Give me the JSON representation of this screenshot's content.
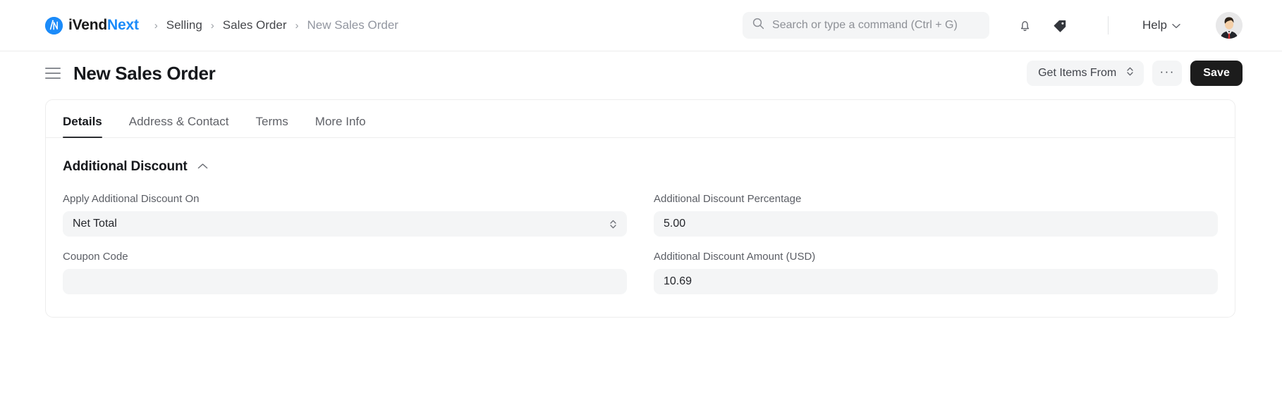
{
  "navbar": {
    "brand": {
      "part1": "iVend",
      "part2": "Next",
      "logo_icon": "ivend-logo-icon",
      "logo_color": "#1b8bf9"
    },
    "breadcrumbs": [
      {
        "label": "Selling",
        "current": false
      },
      {
        "label": "Sales Order",
        "current": false
      },
      {
        "label": "New Sales Order",
        "current": true
      }
    ],
    "breadcrumb_separator": "›",
    "search": {
      "placeholder": "Search or type a command (Ctrl + G)",
      "icon": "search-icon"
    },
    "notifications_icon": "bell-icon",
    "tag_icon": "tag-icon",
    "help": {
      "label": "Help",
      "icon": "chevron-down-icon"
    },
    "avatar_icon": "user-avatar"
  },
  "page_header": {
    "menu_icon": "hamburger-icon",
    "title": "New Sales Order",
    "get_items_from": {
      "label": "Get Items From",
      "icon": "select-chevrons-icon"
    },
    "more_actions_label": "···",
    "save_label": "Save",
    "save_color": "#1c1c1c"
  },
  "tabs": [
    {
      "label": "Details",
      "active": true
    },
    {
      "label": "Address & Contact",
      "active": false
    },
    {
      "label": "Terms",
      "active": false
    },
    {
      "label": "More Info",
      "active": false
    }
  ],
  "section": {
    "title": "Additional Discount",
    "collapse_icon": "chevron-up-icon",
    "expanded": true
  },
  "fields": [
    {
      "label": "Apply Additional Discount On",
      "value": "Net Total",
      "type": "select",
      "name": "apply-additional-discount-on"
    },
    {
      "label": "Additional Discount Percentage",
      "value": "5.00",
      "type": "text",
      "name": "additional-discount-percentage"
    },
    {
      "label": "Coupon Code",
      "value": "",
      "type": "text",
      "name": "coupon-code"
    },
    {
      "label": "Additional Discount Amount (USD)",
      "value": "10.69",
      "type": "text",
      "name": "additional-discount-amount"
    }
  ]
}
